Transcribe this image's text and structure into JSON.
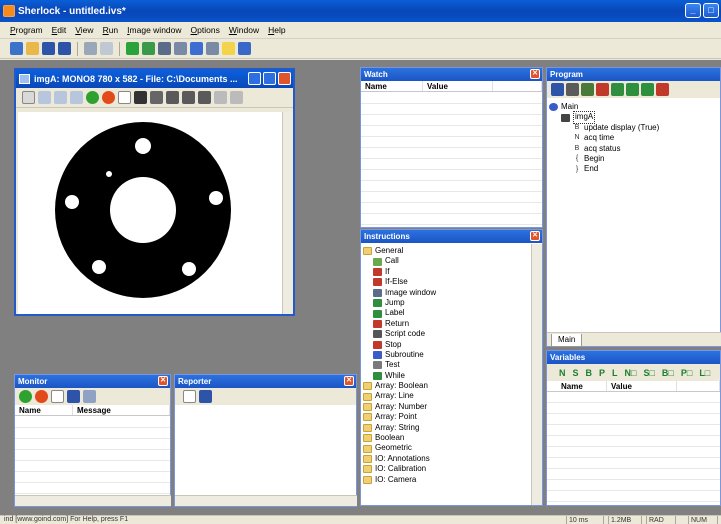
{
  "window": {
    "title": "Sherlock - untitled.ivs*",
    "buttons": [
      "_",
      "□",
      "✕"
    ]
  },
  "menu": [
    "Program",
    "Edit",
    "View",
    "Run",
    "Image window",
    "Options",
    "Window",
    "Help"
  ],
  "image_window": {
    "title": "imgA: MONO8 780 x 582 - File: C:\\Documents ...",
    "image": "black disc with center hole and five small holes"
  },
  "watch": {
    "title": "Watch",
    "columns": [
      "Name",
      "Value"
    ]
  },
  "program": {
    "title": "Program",
    "toolbar_labels": [
      "ACQ",
      "Script",
      "RET",
      "CALL",
      "JUMP",
      "LBL",
      "While",
      "STOP"
    ],
    "tree": [
      {
        "label": "Main",
        "level": 0,
        "icon": "main-icon"
      },
      {
        "label": "imgA",
        "level": 1,
        "icon": "image-icon"
      },
      {
        "label": "update display (True)",
        "level": 2,
        "icon": "boolean-icon",
        "prefix": "B"
      },
      {
        "label": "acq time",
        "level": 2,
        "icon": "number-icon",
        "prefix": "N"
      },
      {
        "label": "acq status",
        "level": 2,
        "icon": "boolean-icon",
        "prefix": "B"
      },
      {
        "label": "Begin",
        "level": 2,
        "icon": "brace-icon",
        "prefix": "{"
      },
      {
        "label": "End",
        "level": 2,
        "icon": "brace-icon",
        "prefix": "}"
      }
    ],
    "tab": "Main"
  },
  "instructions": {
    "title": "Instructions",
    "general": "General",
    "items": [
      "Call",
      "If",
      "If-Else",
      "Image window",
      "Jump",
      "Label",
      "Return",
      "Script code",
      "Stop",
      "Subroutine",
      "Test",
      "While"
    ],
    "folders": [
      "Array: Boolean",
      "Array: Line",
      "Array: Number",
      "Array: Point",
      "Array: String",
      "Boolean",
      "Geometric",
      "IO: Annotations",
      "IO: Calibration",
      "IO: Camera"
    ]
  },
  "variables": {
    "title": "Variables",
    "type_buttons": [
      "N",
      "S",
      "B",
      "P",
      "L",
      "N□",
      "S□",
      "B□",
      "P□",
      "L□"
    ],
    "columns": [
      "Name",
      "Value"
    ]
  },
  "monitor": {
    "title": "Monitor",
    "columns": [
      "Name",
      "Message"
    ]
  },
  "reporter": {
    "title": "Reporter"
  },
  "status": {
    "left": "ind [www.goind.com]  For Help, press F1",
    "time": "10 ms",
    "memory": "1.2MB",
    "rad": "RAD",
    "num": "NUM"
  }
}
